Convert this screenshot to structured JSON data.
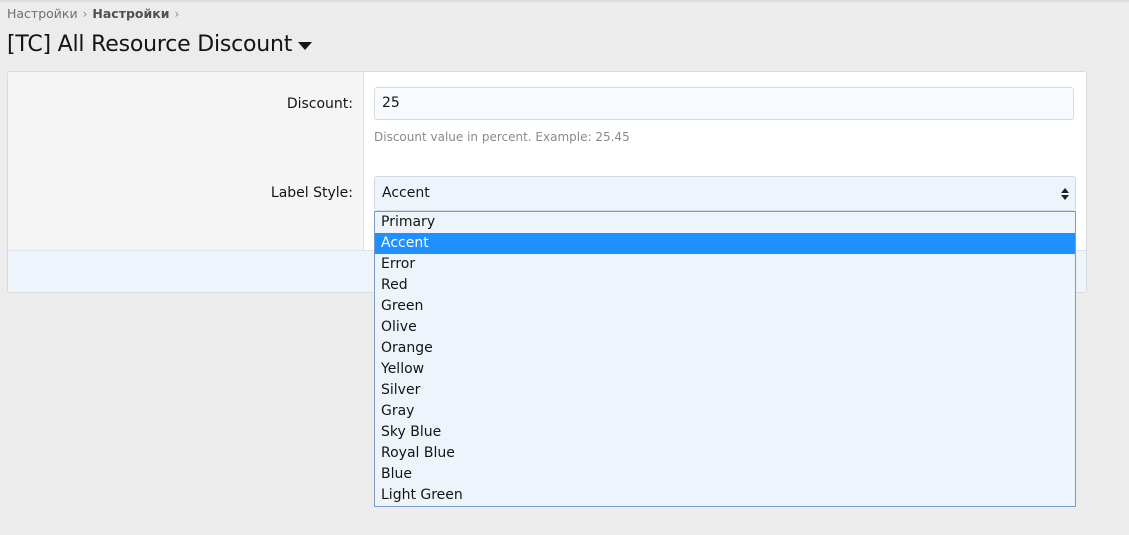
{
  "breadcrumb": {
    "items": [
      "Настройки",
      "Настройки"
    ],
    "separator": "›"
  },
  "page": {
    "title": "[TC] All Resource Discount"
  },
  "form": {
    "discount": {
      "label": "Discount:",
      "value": "25",
      "hint": "Discount value in percent. Example: 25.45"
    },
    "label_style": {
      "label": "Label Style:",
      "selected": "Accent",
      "options": [
        "Primary",
        "Accent",
        "Error",
        "Red",
        "Green",
        "Olive",
        "Orange",
        "Yellow",
        "Silver",
        "Gray",
        "Sky Blue",
        "Royal Blue",
        "Blue",
        "Light Green"
      ]
    }
  },
  "colors": {
    "highlight": "#1e90ff",
    "background": "#ececec",
    "input_background": "#eef4fb"
  }
}
